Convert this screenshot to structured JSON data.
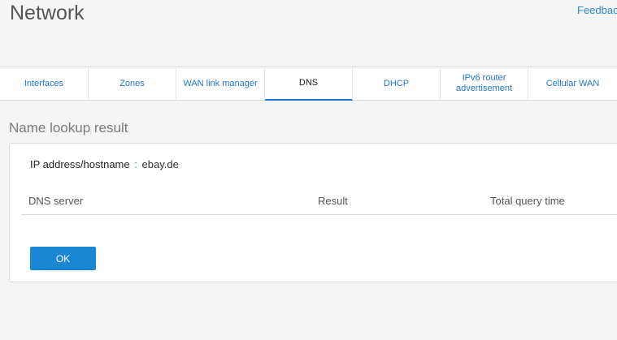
{
  "header": {
    "title": "Network",
    "feedback_link": "Feedback"
  },
  "tabs": [
    {
      "label": "Interfaces",
      "active": false
    },
    {
      "label": "Zones",
      "active": false
    },
    {
      "label": "WAN link manager",
      "active": false
    },
    {
      "label": "DNS",
      "active": true
    },
    {
      "label": "DHCP",
      "active": false
    },
    {
      "label": "IPv6 router advertisement",
      "active": false
    },
    {
      "label": "Cellular WAN",
      "active": false
    }
  ],
  "section": {
    "title": "Name lookup result"
  },
  "result": {
    "ip_label": "IP address/hostname",
    "ip_separator": ":",
    "ip_value": "ebay.de",
    "columns": [
      "DNS server",
      "Result",
      "Total query time"
    ],
    "rows": []
  },
  "actions": {
    "ok_label": "OK"
  },
  "colors": {
    "accent": "#1e78c8",
    "button": "#1b86d4",
    "background": "#f5f5f5"
  }
}
